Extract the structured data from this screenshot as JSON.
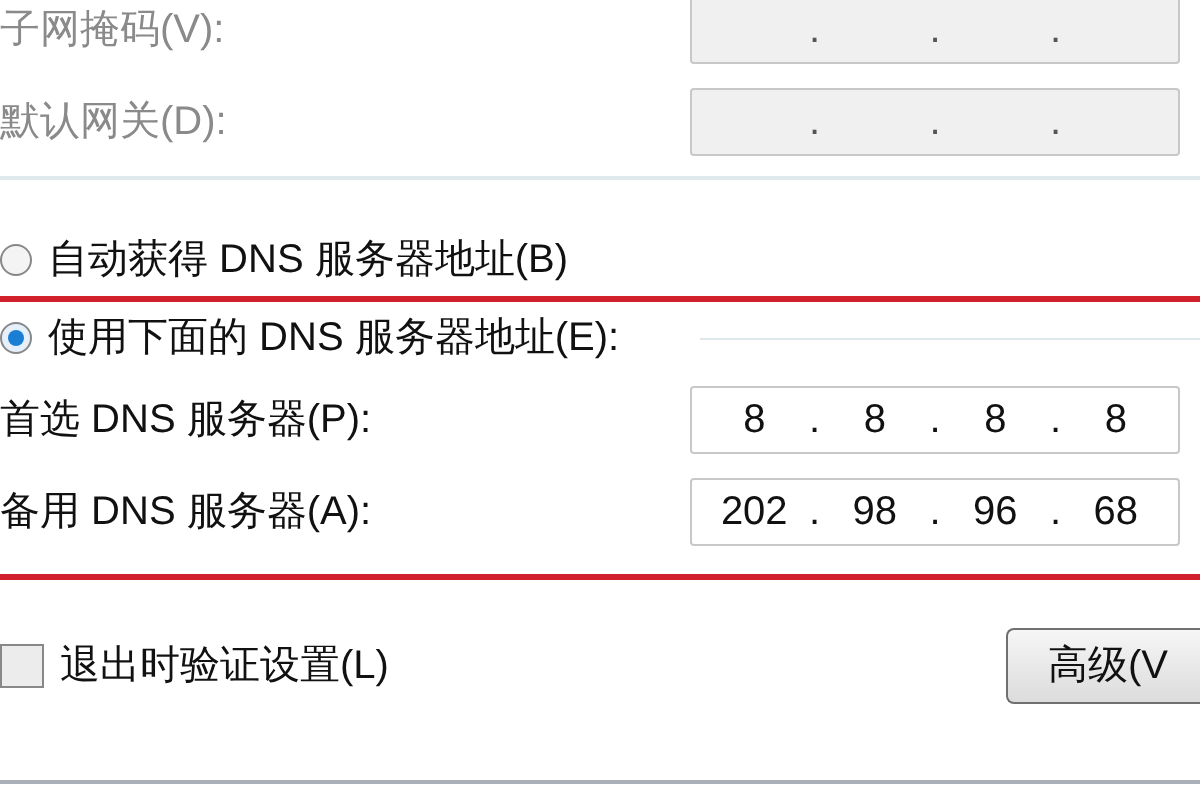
{
  "ip_fields": [
    {
      "label": "子网掩码(V):",
      "disabled": true,
      "dots": [
        ".",
        ".",
        "."
      ]
    },
    {
      "label": "默认网关(D):",
      "disabled": true,
      "dots": [
        ".",
        ".",
        "."
      ]
    }
  ],
  "dns_options": [
    {
      "label": "自动获得 DNS 服务器地址(B)",
      "selected": false
    },
    {
      "label": "使用下面的 DNS 服务器地址(E):",
      "selected": true
    }
  ],
  "dns_fields": [
    {
      "label": "首选 DNS 服务器(P):",
      "disabled": false,
      "octets": [
        "8",
        "8",
        "8",
        "8"
      ],
      "dots": [
        ".",
        ".",
        "."
      ]
    },
    {
      "label": "备用 DNS 服务器(A):",
      "disabled": false,
      "octets": [
        "202",
        "98",
        "96",
        "68"
      ],
      "dots": [
        ".",
        ".",
        "."
      ]
    }
  ],
  "validate_checkbox": {
    "label": "退出时验证设置(L)",
    "checked": false
  },
  "advanced_button": {
    "label": "高级(V"
  }
}
